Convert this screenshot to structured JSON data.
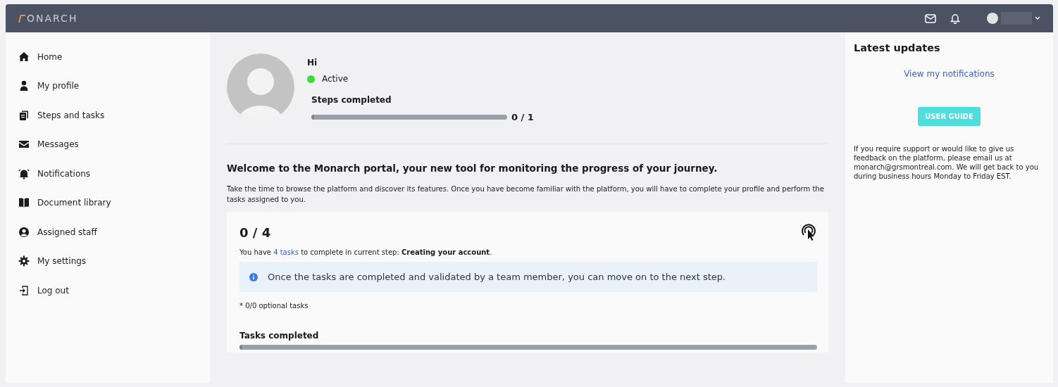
{
  "header": {
    "logo": "ONARCH"
  },
  "sidebar": {
    "items": [
      {
        "label": "Home"
      },
      {
        "label": "My profile"
      },
      {
        "label": "Steps and tasks"
      },
      {
        "label": "Messages"
      },
      {
        "label": "Notifications"
      },
      {
        "label": "Document library"
      },
      {
        "label": "Assigned staff"
      },
      {
        "label": "My settings"
      },
      {
        "label": "Log out"
      }
    ]
  },
  "profile": {
    "greeting": "Hi",
    "status": {
      "label": "Active",
      "color": "#3ddc3d"
    },
    "steps_label": "Steps completed",
    "steps": {
      "level": 0
    },
    "steps_count": "0 / 1"
  },
  "welcome": {
    "title": "Welcome to the Monarch portal, your new tool for monitoring the progress of your journey.",
    "text": "Take the time to browse the platform and discover its features. Once you have become familiar with the platform, you will have to complete your profile and perform the tasks assigned to you."
  },
  "tasks": {
    "count": "0 / 4",
    "before": "You have ",
    "link": "4 tasks",
    "after": " to complete in current step: **Creating your account**.",
    "info": "Once the tasks are completed and validated by a team member, you can move on to the next step.",
    "optional": "* 0/0 optional tasks",
    "completed_label": "Tasks completed",
    "completed": {
      "level": 0
    }
  },
  "updates": {
    "title": "Latest updates",
    "link": "View my notifications",
    "button": "USER GUIDE",
    "text": "If you require support or would like to give us feedback on the platform, please email us at monarch@grsmontreal.com. We will get back to you during business hours Monday to Friday EST."
  }
}
